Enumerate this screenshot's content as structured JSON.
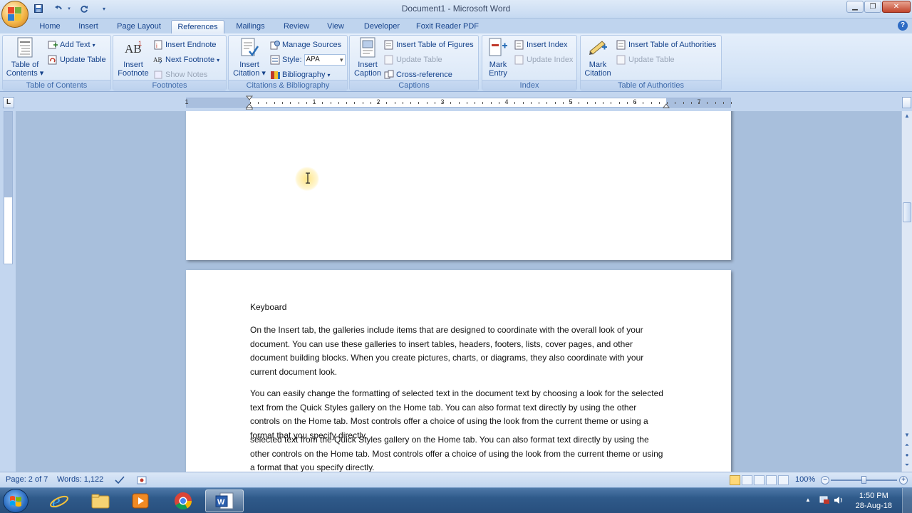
{
  "window": {
    "title": "Document1 - Microsoft Word"
  },
  "tabs": [
    "Home",
    "Insert",
    "Page Layout",
    "References",
    "Mailings",
    "Review",
    "View",
    "Developer",
    "Foxit Reader PDF"
  ],
  "active_tab": "References",
  "ribbon": {
    "toc": {
      "label": "Table of Contents",
      "big_button": [
        "Table of",
        "Contents"
      ],
      "add_text": "Add Text",
      "update_table": "Update Table"
    },
    "footnotes": {
      "label": "Footnotes",
      "insert_footnote": [
        "Insert",
        "Footnote"
      ],
      "insert_endnote": "Insert Endnote",
      "next_footnote": "Next Footnote",
      "show_notes": "Show Notes"
    },
    "citations": {
      "label": "Citations & Bibliography",
      "insert_citation": [
        "Insert",
        "Citation"
      ],
      "manage_sources": "Manage Sources",
      "style_label": "Style:",
      "style_value": "APA",
      "bibliography": "Bibliography"
    },
    "captions": {
      "label": "Captions",
      "insert_caption": [
        "Insert",
        "Caption"
      ],
      "insert_table_of_figures": "Insert Table of Figures",
      "update_table": "Update Table",
      "cross_reference": "Cross-reference"
    },
    "index": {
      "label": "Index",
      "mark_entry": [
        "Mark",
        "Entry"
      ],
      "insert_index": "Insert Index",
      "update_index": "Update Index"
    },
    "authorities": {
      "label": "Table of Authorities",
      "mark_citation": [
        "Mark",
        "Citation"
      ],
      "insert_toa": "Insert Table of Authorities",
      "update_table": "Update Table"
    }
  },
  "ruler": {
    "numbers": [
      "1",
      "1",
      "2",
      "3",
      "4",
      "5",
      "6",
      "7"
    ]
  },
  "document": {
    "heading": "Keyboard",
    "paragraph1": "On the Insert tab, the galleries include items that are designed to coordinate with the overall look of your document. You can use these galleries to insert tables, headers, footers, lists, cover pages, and other document building blocks. When you create pictures, charts, or diagrams, they also coordinate with your current document look.",
    "paragraph2": "You can easily change the formatting of selected text in the document text by choosing a look for the selected text from the Quick Styles gallery on the Home tab. You can also format text directly by using the other controls on the Home tab. Most controls offer a choice of using the look from the current theme or using a format that you specify directly.",
    "paragraph2_tail": "selected text from the Quick Styles gallery on the Home tab. You can also format text directly by using the other controls on the Home tab. Most controls offer a choice of using the look from the current theme or using a format that you specify directly."
  },
  "statusbar": {
    "page": "Page: 2 of 7",
    "words": "Words: 1,122",
    "zoom": "100%"
  },
  "taskbar": {
    "time": "1:50 PM",
    "date": "28-Aug-18"
  },
  "colors": {
    "ribbon_text": "#15428b",
    "doc_background": "#a8bfdc",
    "taskbar": "#2f5a8a"
  }
}
